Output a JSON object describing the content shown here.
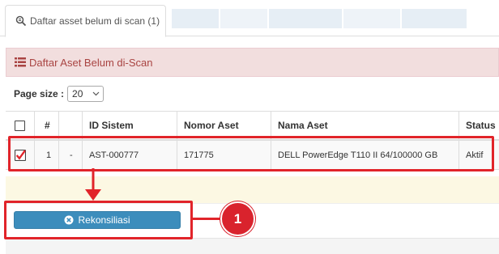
{
  "tabs": [
    {
      "label": "Daftar asset belum di scan (1)",
      "active": true
    }
  ],
  "panel": {
    "title": "Daftar Aset Belum di-Scan"
  },
  "pagination": {
    "label": "Page size :",
    "value": "20"
  },
  "table": {
    "columns": [
      "",
      "#",
      "",
      "ID Sistem",
      "Nomor Aset",
      "Nama Aset",
      "Status"
    ],
    "rows": [
      {
        "checked": true,
        "no": "1",
        "dash": "-",
        "id_sistem": "AST-000777",
        "nomor_aset": "171775",
        "nama_aset": "DELL PowerEdge T110 II 64/100000 GB",
        "status": "Aktif"
      }
    ]
  },
  "actions": {
    "reconcile_label": "Rekonsiliasi"
  },
  "annotation": {
    "step": "1"
  },
  "colors": {
    "danger_panel_bg": "#f2dede",
    "danger_text": "#a94442",
    "primary_button": "#3c8dbc",
    "annotation_red": "#e1242a"
  },
  "icons": {
    "tab": "search-list-icon",
    "panel": "list-icon",
    "button": "times-circle-icon"
  }
}
